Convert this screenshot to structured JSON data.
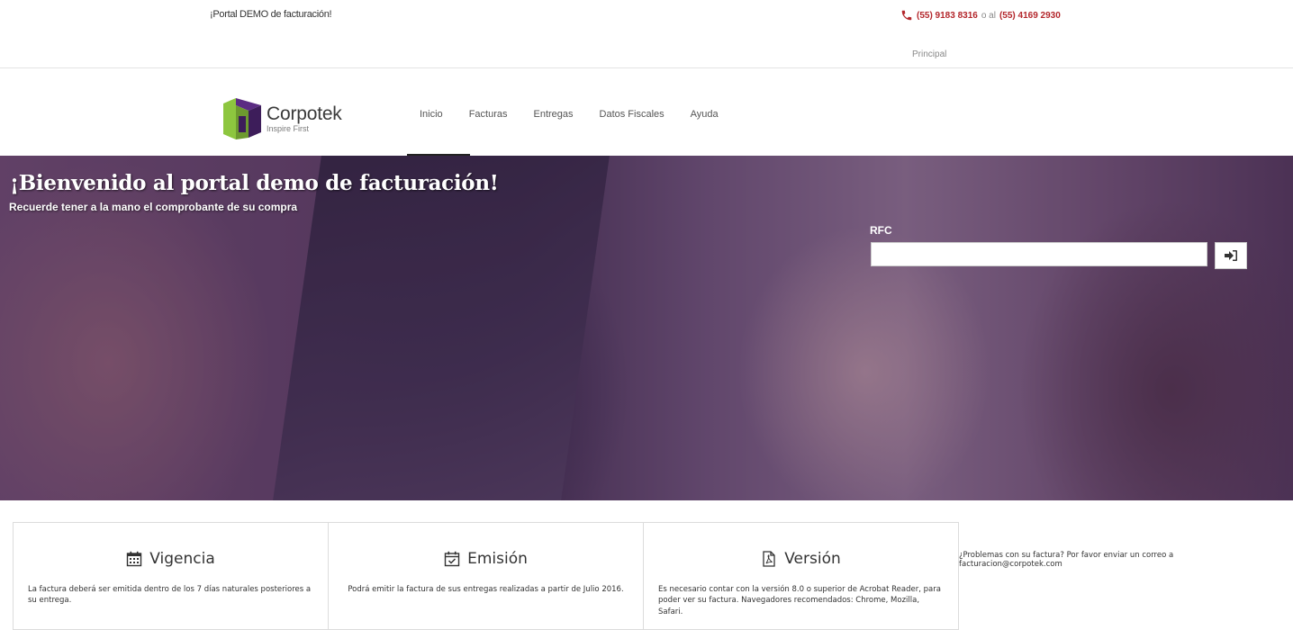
{
  "topbar": {
    "tagline": "¡Portal DEMO de facturación!",
    "phone_primary": "(55) 9183 8316",
    "phone_separator": "o al",
    "phone_secondary": "(55) 4169 2930",
    "principal_link": "Principal"
  },
  "header": {
    "logo_name": "Corpotek",
    "logo_sub": "Inspire First",
    "nav": [
      {
        "label": "Inicio",
        "active": true
      },
      {
        "label": "Facturas",
        "active": false
      },
      {
        "label": "Entregas",
        "active": false
      },
      {
        "label": "Datos Fiscales",
        "active": false
      },
      {
        "label": "Ayuda",
        "active": false
      }
    ]
  },
  "hero": {
    "title": "¡Bienvenido al portal demo de facturación!",
    "subtitle": "Recuerde tener a la mano el comprobante de su compra",
    "rfc_label": "RFC",
    "rfc_value": "",
    "submit_icon": "sign-in-icon"
  },
  "cards": [
    {
      "icon": "calendar-icon",
      "title": "Vigencia",
      "text": "La factura deberá ser emitida dentro de los 7 días naturales posteriores a su entrega."
    },
    {
      "icon": "calendar-check-icon",
      "title": "Emisión",
      "text": "Podrá emitir la factura de sus entregas realizadas a partir de Julio 2016."
    },
    {
      "icon": "pdf-file-icon",
      "title": "Versión",
      "text": "Es necesario contar con la versión 8.0 o superior de Acrobat Reader, para poder ver su factura. Navegadores recomendados: Chrome, Mozilla, Safari."
    }
  ],
  "side_note": "¿Problemas con su factura? Por favor enviar un correo a facturacion@corpotek.com",
  "colors": {
    "accent_red": "#b3262b",
    "hero_tint": "#5a3f5f",
    "logo_green": "#8dc63f",
    "logo_purple": "#5b2c83"
  }
}
